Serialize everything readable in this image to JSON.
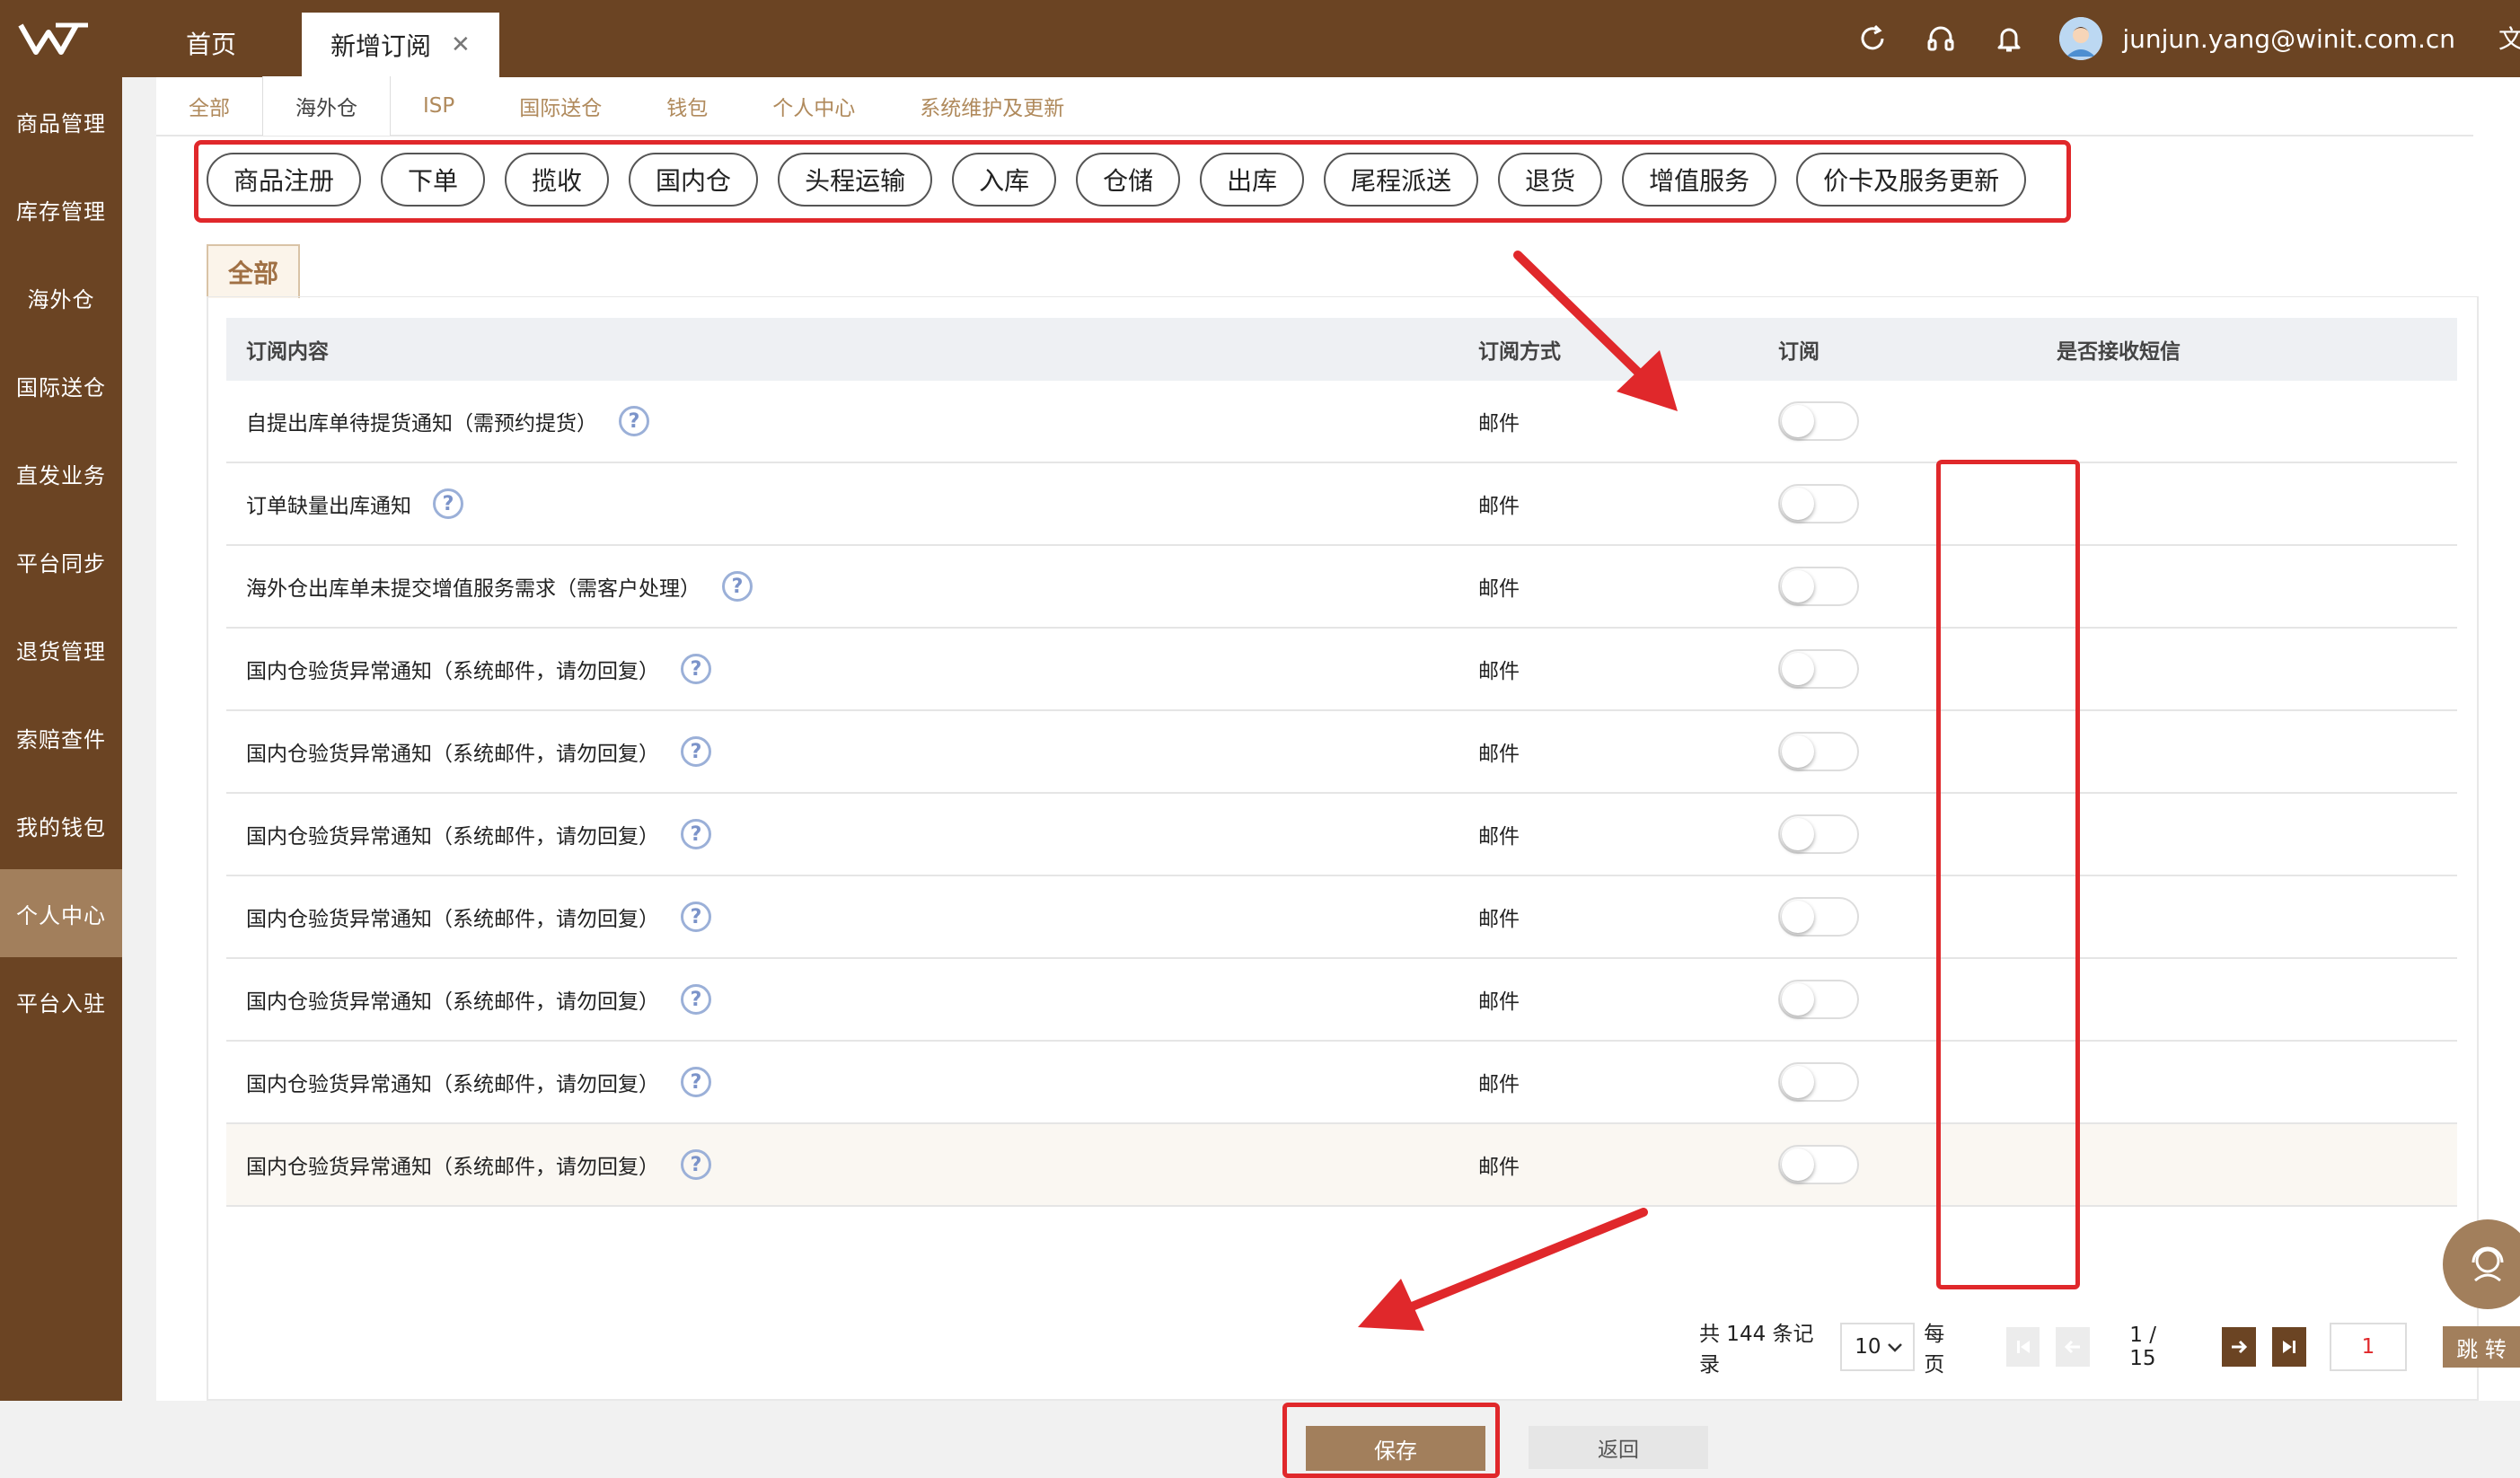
{
  "topbar": {
    "home_tab": "首页",
    "active_tab": "新增订阅",
    "close_glyph": "✕",
    "user_email": "junjun.yang@winit.com.cn",
    "lang": "文"
  },
  "sidebar": {
    "items": [
      {
        "label": "商品管理"
      },
      {
        "label": "库存管理"
      },
      {
        "label": "海外仓"
      },
      {
        "label": "国际送仓"
      },
      {
        "label": "直发业务"
      },
      {
        "label": "平台同步"
      },
      {
        "label": "退货管理"
      },
      {
        "label": "索赔查件"
      },
      {
        "label": "我的钱包"
      },
      {
        "label": "个人中心"
      },
      {
        "label": "平台入驻"
      }
    ],
    "active_index": 9
  },
  "category_tabs": [
    "全部",
    "海外仓",
    "ISP",
    "国际送仓",
    "钱包",
    "个人中心",
    "系统维护及更新"
  ],
  "active_category": "海外仓",
  "pills": [
    "商品注册",
    "下单",
    "揽收",
    "国内仓",
    "头程运输",
    "入库",
    "仓储",
    "出库",
    "尾程派送",
    "退货",
    "增值服务",
    "价卡及服务更新"
  ],
  "sub_tab": "全部",
  "table": {
    "headers": {
      "content": "订阅内容",
      "method": "订阅方式",
      "subscribe": "订阅",
      "sms": "是否接收短信"
    },
    "help_glyph": "?",
    "rows": [
      {
        "content": "自提出库单待提货通知（需预约提货）",
        "method": "邮件",
        "subscribed": false
      },
      {
        "content": "订单缺量出库通知",
        "method": "邮件",
        "subscribed": false
      },
      {
        "content": "海外仓出库单未提交增值服务需求（需客户处理）",
        "method": "邮件",
        "subscribed": false
      },
      {
        "content": "国内仓验货异常通知（系统邮件，请勿回复）",
        "method": "邮件",
        "subscribed": false
      },
      {
        "content": "国内仓验货异常通知（系统邮件，请勿回复）",
        "method": "邮件",
        "subscribed": false
      },
      {
        "content": "国内仓验货异常通知（系统邮件，请勿回复）",
        "method": "邮件",
        "subscribed": false
      },
      {
        "content": "国内仓验货异常通知（系统邮件，请勿回复）",
        "method": "邮件",
        "subscribed": false
      },
      {
        "content": "国内仓验货异常通知（系统邮件，请勿回复）",
        "method": "邮件",
        "subscribed": false
      },
      {
        "content": "国内仓验货异常通知（系统邮件，请勿回复）",
        "method": "邮件",
        "subscribed": false
      },
      {
        "content": "国内仓验货异常通知（系统邮件，请勿回复）",
        "method": "邮件",
        "subscribed": false
      }
    ]
  },
  "pager": {
    "total": "共 144 条记录",
    "page_size": "10",
    "per_page_label": "每页",
    "page_info": "1 / 15",
    "page_input": "1",
    "go_label": "跳 转"
  },
  "actions": {
    "save": "保存",
    "back": "返回"
  },
  "colors": {
    "brand_brown": "#6b4423",
    "accent_tan": "#a27f5c",
    "highlight_red": "#e0282b"
  }
}
